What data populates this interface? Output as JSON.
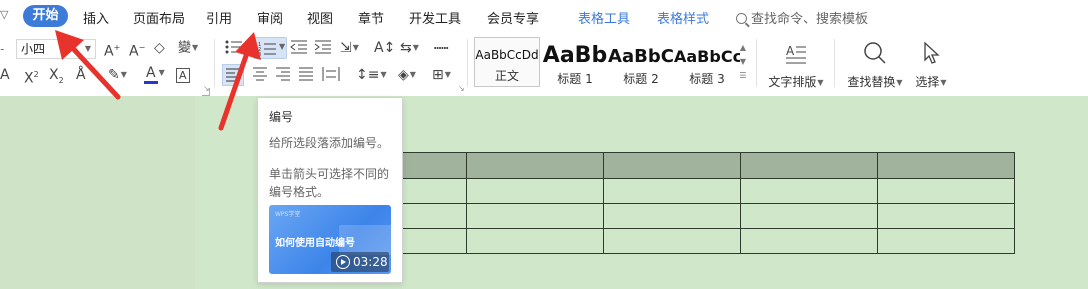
{
  "menubar": {
    "active_tab": "开始",
    "tabs": [
      "插入",
      "页面布局",
      "引用",
      "审阅",
      "视图",
      "章节",
      "开发工具",
      "会员专享"
    ],
    "context_tabs": [
      "表格工具",
      "表格样式"
    ],
    "search_placeholder": "查找命令、搜索模板"
  },
  "ribbon": {
    "font_size": "小四",
    "styles": [
      {
        "sample": "AaBbCcDd",
        "name": "正文"
      },
      {
        "sample": "AaBb",
        "name": "标题 1"
      },
      {
        "sample": "AaBbC",
        "name": "标题 2"
      },
      {
        "sample": "AaBbCc",
        "name": "标题 3"
      }
    ],
    "text_layout_label": "文字排版",
    "find_replace_label": "查找替换",
    "select_label": "选择"
  },
  "tooltip": {
    "title": "编号",
    "description": "给所选段落添加编号。",
    "hint": "单击箭头可选择不同的编号格式。",
    "video_watermark": "WPS学堂",
    "video_title": "如何使用自动编号",
    "video_duration": "03:28"
  },
  "colors": {
    "accent": "#3d7bd9",
    "page_background": "#d0e8c9",
    "table_header": "#a1b39c",
    "annotation_arrow": "#e8322c"
  }
}
